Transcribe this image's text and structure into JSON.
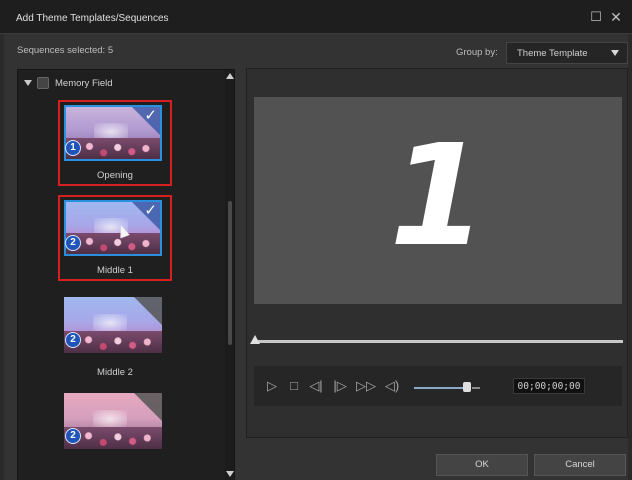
{
  "window": {
    "title": "Add Theme Templates/Sequences",
    "maximize_icon": "maximize-icon",
    "close_icon": "close-icon"
  },
  "toolbar": {
    "sequences_selected": "Sequences selected: 5",
    "group_by_label": "Group by:",
    "group_by_value": "Theme Template"
  },
  "tree": {
    "group_label": "Memory Field",
    "items": [
      {
        "label": "Opening",
        "badge": "1",
        "selected": true
      },
      {
        "label": "Middle 1",
        "badge": "2",
        "selected": true
      },
      {
        "label": "Middle 2",
        "badge": "2",
        "selected": false
      },
      {
        "label": "",
        "badge": "2",
        "selected": false
      }
    ]
  },
  "preview": {
    "number": "1",
    "timecode": "00;00;00;00",
    "seek_progress": 0,
    "volume_level": 0.85
  },
  "controls": {
    "play_icon": "play-icon",
    "stop_icon": "stop-icon",
    "prev_frame_icon": "previous-frame-icon",
    "next_frame_icon": "next-frame-icon",
    "fast_forward_icon": "fast-forward-icon",
    "volume_icon": "volume-icon"
  },
  "buttons": {
    "ok": "OK",
    "cancel": "Cancel"
  },
  "colors": {
    "selection_border": "#d42020",
    "thumbnail_highlight": "#2b8fe0",
    "badge": "#1f55b8"
  }
}
